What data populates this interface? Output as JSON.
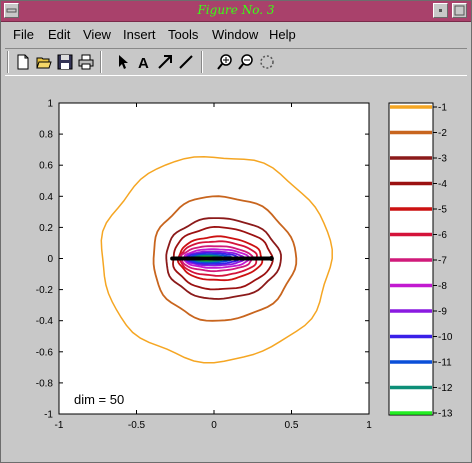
{
  "window": {
    "title": "Figure No. 3"
  },
  "menu": [
    "File",
    "Edit",
    "View",
    "Insert",
    "Tools",
    "Window",
    "Help"
  ],
  "toolbar": {
    "groups": [
      [
        "new-file-icon",
        "open-folder-icon",
        "save-disk-icon",
        "print-icon"
      ],
      [
        "arrow-pointer-icon",
        "text-a-icon",
        "draw-arrow-icon",
        "draw-line-icon"
      ],
      [
        "zoom-in-icon",
        "zoom-out-icon",
        "rotate-icon"
      ]
    ]
  },
  "chart_data": {
    "type": "contour",
    "xlim": [
      -1,
      1
    ],
    "ylim": [
      -1,
      1
    ],
    "xticks": [
      "-1",
      "-0.5",
      "0",
      "0.5",
      "1"
    ],
    "yticks": [
      "1",
      "0.8",
      "0.6",
      "0.4",
      "0.2",
      "0",
      "-0.2",
      "-0.4",
      "-0.6",
      "-0.8",
      "-1"
    ],
    "annotation": "dim = 50",
    "grid": false,
    "colorbar": {
      "levels": [
        "-1",
        "-2",
        "-3",
        "-4",
        "-5",
        "-6",
        "-7",
        "-8",
        "-9",
        "-10",
        "-11",
        "-12",
        "-13"
      ],
      "colors": [
        "#f5a623",
        "#c8651e",
        "#8b1a1a",
        "#9b1111",
        "#cc1111",
        "#d4133a",
        "#d01a7a",
        "#c21ad0",
        "#8a1ae0",
        "#3a20e8",
        "#0a4fd8",
        "#0d8f78",
        "#22ee22"
      ]
    },
    "contours": [
      {
        "level": -1,
        "center": [
          0.0,
          0.0
        ],
        "rx": 0.74,
        "ry": 0.66
      },
      {
        "level": -2,
        "center": [
          0.03,
          0.0
        ],
        "rx": 0.46,
        "ry": 0.4
      },
      {
        "level": -3,
        "center": [
          0.03,
          0.0
        ],
        "rx": 0.37,
        "ry": 0.26
      },
      {
        "level": -4,
        "center": [
          0.03,
          0.0
        ],
        "rx": 0.32,
        "ry": 0.2
      },
      {
        "level": -5,
        "center": [
          0.02,
          0.0
        ],
        "rx": 0.27,
        "ry": 0.14
      },
      {
        "level": -6,
        "center": [
          0.01,
          0.0
        ],
        "rx": 0.25,
        "ry": 0.11
      },
      {
        "level": -7,
        "center": [
          0.0,
          0.0
        ],
        "rx": 0.23,
        "ry": 0.08
      },
      {
        "level": -8,
        "center": [
          0.0,
          0.0
        ],
        "rx": 0.21,
        "ry": 0.06
      },
      {
        "level": -9,
        "center": [
          -0.01,
          0.0
        ],
        "rx": 0.19,
        "ry": 0.045
      },
      {
        "level": -10,
        "center": [
          -0.02,
          0.0
        ],
        "rx": 0.17,
        "ry": 0.035
      },
      {
        "level": -11,
        "center": [
          -0.03,
          0.0
        ],
        "rx": 0.14,
        "ry": 0.025
      },
      {
        "level": -12,
        "center": [
          -0.04,
          0.0
        ],
        "rx": 0.1,
        "ry": 0.018
      },
      {
        "level": -13,
        "center": [
          -0.05,
          0.0
        ],
        "rx": 0.06,
        "ry": 0.01
      }
    ],
    "segment": {
      "x": [
        -0.27,
        0.37
      ],
      "y": [
        0.0,
        0.0
      ],
      "color": "#000000"
    }
  }
}
